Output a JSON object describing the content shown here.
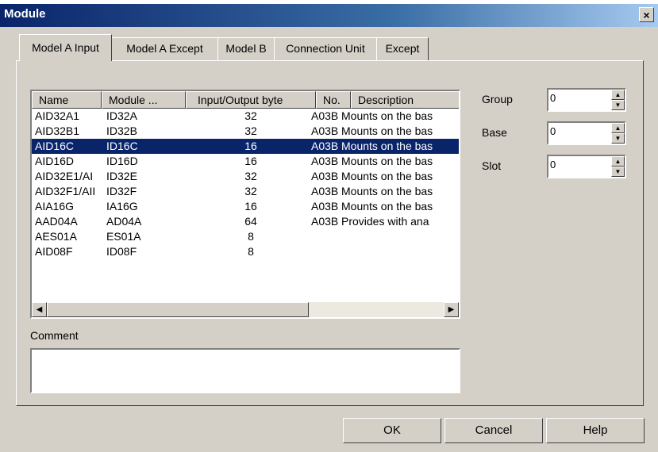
{
  "window": {
    "title": "Module",
    "close_glyph": "×"
  },
  "tabs": [
    {
      "label": "Model A Input",
      "active": true
    },
    {
      "label": "Model A Except",
      "active": false
    },
    {
      "label": "Model B",
      "active": false
    },
    {
      "label": "Connection Unit",
      "active": false
    },
    {
      "label": "Except",
      "active": false
    }
  ],
  "list": {
    "columns": [
      "Name",
      "Module ...",
      "Input/Output byte",
      "No.",
      "Description"
    ],
    "rows": [
      {
        "name": "AID32A1",
        "module": "ID32A",
        "io": "32",
        "no": "A03B",
        "desc": "Mounts on the bas",
        "selected": false
      },
      {
        "name": "AID32B1",
        "module": "ID32B",
        "io": "32",
        "no": "A03B",
        "desc": "Mounts on the bas",
        "selected": false
      },
      {
        "name": "AID16C",
        "module": "ID16C",
        "io": "16",
        "no": "A03B",
        "desc": "Mounts on the bas",
        "selected": true
      },
      {
        "name": "AID16D",
        "module": "ID16D",
        "io": "16",
        "no": "A03B",
        "desc": "Mounts on the bas",
        "selected": false
      },
      {
        "name": "AID32E1/AI",
        "module": "ID32E",
        "io": "32",
        "no": "A03B",
        "desc": "Mounts on the bas",
        "selected": false
      },
      {
        "name": "AID32F1/AII",
        "module": "ID32F",
        "io": "32",
        "no": "A03B",
        "desc": "Mounts on the bas",
        "selected": false
      },
      {
        "name": "AIA16G",
        "module": "IA16G",
        "io": "16",
        "no": "A03B",
        "desc": "Mounts on the bas",
        "selected": false
      },
      {
        "name": "AAD04A",
        "module": "AD04A",
        "io": "64",
        "no": "A03B",
        "desc": "Provides with ana",
        "selected": false
      },
      {
        "name": "AES01A",
        "module": "ES01A",
        "io": "8",
        "no": "",
        "desc": "",
        "selected": false
      },
      {
        "name": "AID08F",
        "module": "ID08F",
        "io": "8",
        "no": "",
        "desc": "",
        "selected": false
      }
    ]
  },
  "fields": {
    "group": {
      "label": "Group",
      "value": "0"
    },
    "base": {
      "label": "Base",
      "value": "0"
    },
    "slot": {
      "label": "Slot",
      "value": "0"
    }
  },
  "comment": {
    "label": "Comment",
    "value": ""
  },
  "buttons": {
    "ok": "OK",
    "cancel": "Cancel",
    "help": "Help"
  },
  "icons": {
    "scroll_left": "◀",
    "scroll_right": "▶",
    "spin_up": "▲",
    "spin_down": "▼"
  }
}
